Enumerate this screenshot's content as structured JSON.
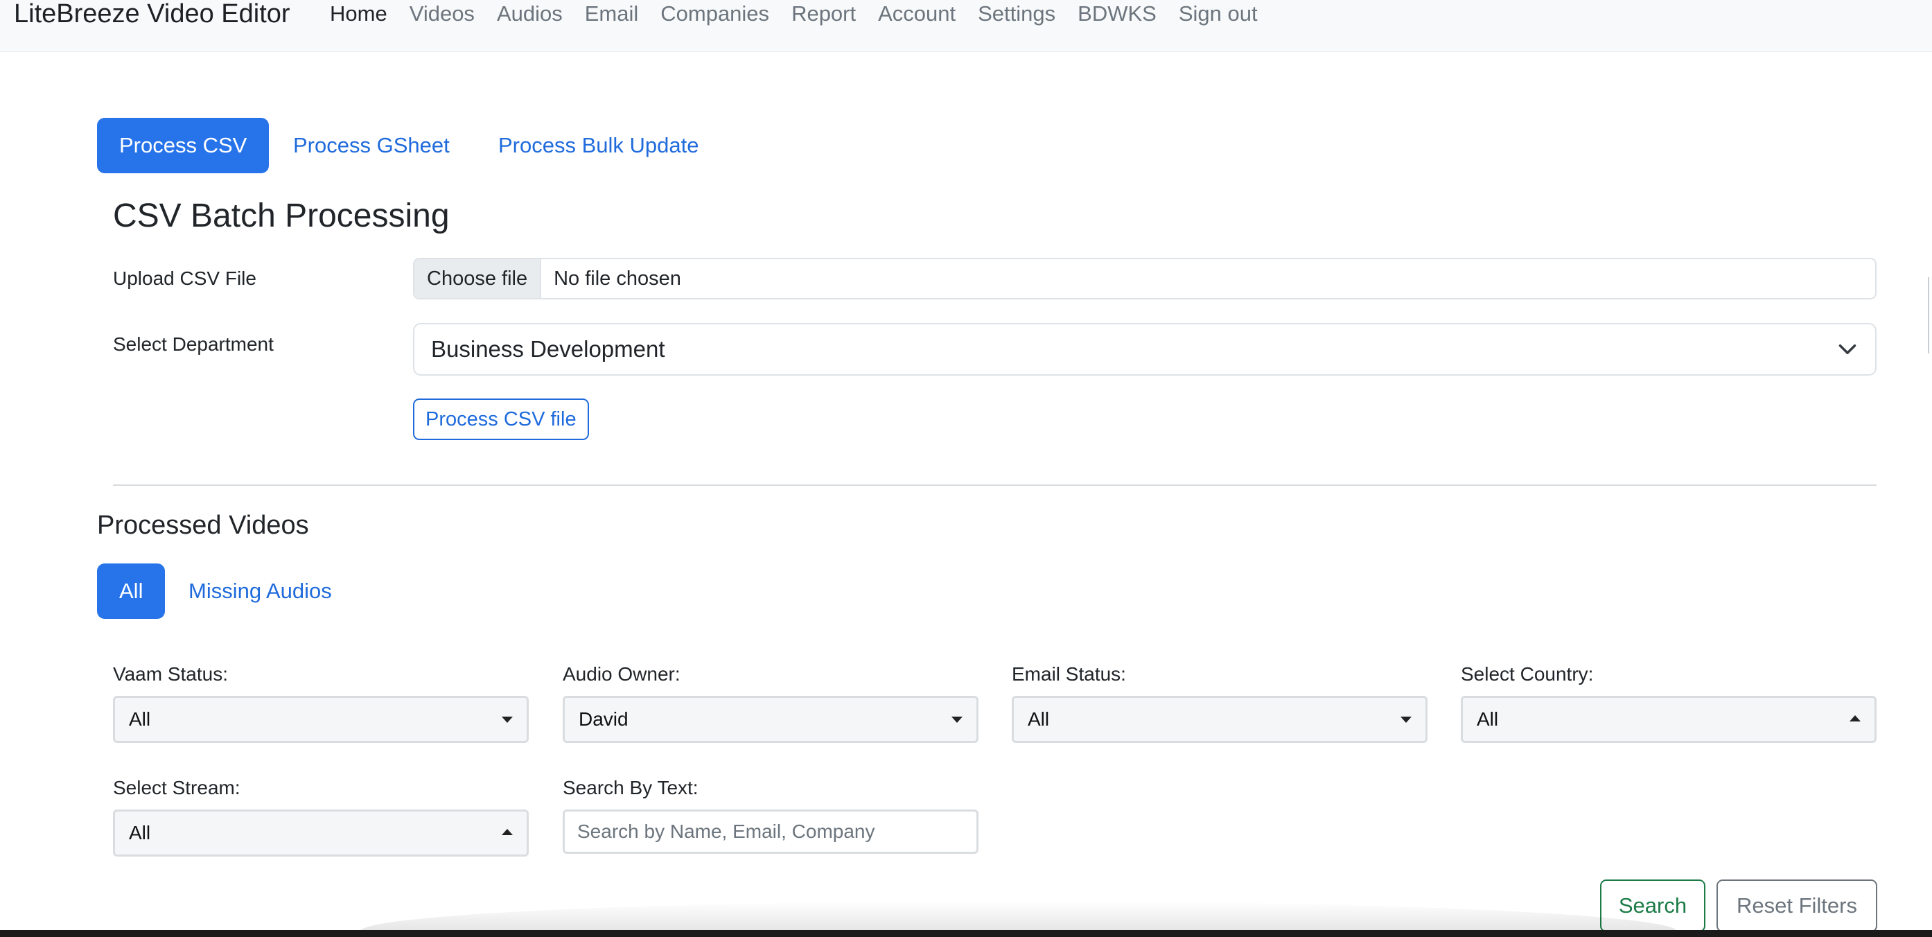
{
  "navbar": {
    "brand": "LiteBreeze Video Editor",
    "links": [
      "Home",
      "Videos",
      "Audios",
      "Email",
      "Companies",
      "Report",
      "Account",
      "Settings",
      "BDWKS",
      "Sign out"
    ],
    "active": "Home"
  },
  "tabs": {
    "items": [
      "Process CSV",
      "Process GSheet",
      "Process Bulk Update"
    ],
    "active": "Process CSV"
  },
  "csv_section": {
    "title": "CSV Batch Processing",
    "upload_label": "Upload CSV File",
    "choose_file": "Choose file",
    "no_file": "No file chosen",
    "department_label": "Select Department",
    "department_value": "Business Development",
    "process_button": "Process CSV file"
  },
  "processed": {
    "title": "Processed Videos",
    "tabs": [
      "All",
      "Missing Audios"
    ],
    "active_tab": "All"
  },
  "filters": {
    "vaam_status": {
      "label": "Vaam Status:",
      "value": "All"
    },
    "audio_owner": {
      "label": "Audio Owner:",
      "value": "David"
    },
    "email_status": {
      "label": "Email Status:",
      "value": "All"
    },
    "country": {
      "label": "Select Country:",
      "value": "All"
    },
    "stream": {
      "label": "Select Stream:",
      "value": "All"
    },
    "search": {
      "label": "Search By Text:",
      "placeholder": "Search by Name, Email, Company",
      "value": ""
    },
    "search_button": "Search",
    "reset_button": "Reset Filters"
  },
  "colors": {
    "primary": "#2774ea",
    "link": "#1f6bdc",
    "success": "#1c7b47",
    "secondary": "#6c757d",
    "navbar_bg": "#f8f9fa"
  }
}
